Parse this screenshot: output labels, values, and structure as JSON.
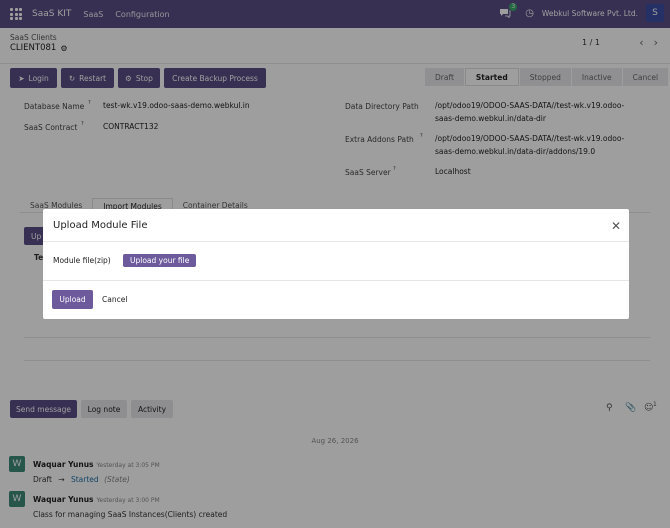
{
  "topbar": {
    "brand": "SaaS KIT",
    "menus": [
      "SaaS",
      "Configuration"
    ],
    "chat_badge": "3",
    "company": "Webkul Software Pvt. Ltd.",
    "avatar_letter": "S"
  },
  "control": {
    "breadcrumb": "SaaS Clients",
    "record_name": "CLIENT081",
    "pager": "1 / 1"
  },
  "actions": {
    "login": "Login",
    "restart": "Restart",
    "stop": "Stop",
    "backup": "Create Backup Process"
  },
  "statusbar": [
    "Draft",
    "Started",
    "Stopped",
    "Inactive",
    "Cancel"
  ],
  "status_active": "Started",
  "fields": {
    "database_name_label": "Database Name",
    "database_name": "test-wk.v19.odoo-saas-demo.webkul.in",
    "contract_label": "SaaS Contract",
    "contract": "CONTRACT132",
    "data_dir_label": "Data Directory Path",
    "data_dir_line1": "/opt/odoo19/ODOO-SAAS-DATA//test-wk.v19.odoo-",
    "data_dir_line2": "saas-demo.webkul.in/data-dir",
    "addons_label": "Extra Addons Path",
    "addons_line1": "/opt/odoo19/ODOO-SAAS-DATA//test-wk.v19.odoo-",
    "addons_line2": "saas-demo.webkul.in/data-dir/addons/19.0",
    "server_label": "SaaS Server",
    "server": "Localhost"
  },
  "tabs": [
    "SaaS Modules",
    "Import Modules",
    "Container Details"
  ],
  "hidden_partial": {
    "btn": "Up",
    "col": "Te"
  },
  "modal": {
    "title": "Upload Module File",
    "field_label": "Module file(zip)",
    "upload_file_button": "Upload your file",
    "upload_button": "Upload",
    "cancel_button": "Cancel"
  },
  "chatter": {
    "send_message": "Send message",
    "log_note": "Log note",
    "activity": "Activity",
    "followers_count": "1",
    "date": "Aug 26, 2026",
    "messages": [
      {
        "avatar": "W",
        "author": "Waquar Yunus",
        "time": "Yesterday at 3:05 PM",
        "from": "Draft",
        "arrow": "→",
        "to": "Started",
        "field": "(State)"
      },
      {
        "avatar": "W",
        "author": "Waquar Yunus",
        "time": "Yesterday at 3:00 PM",
        "body": "Class for managing SaaS Instances(Clients) created"
      }
    ]
  },
  "colors": {
    "brand": "#5b4e86",
    "button": "#6c5a9c",
    "avatar_green": "#3e8b78",
    "link": "#1f6fa8"
  }
}
